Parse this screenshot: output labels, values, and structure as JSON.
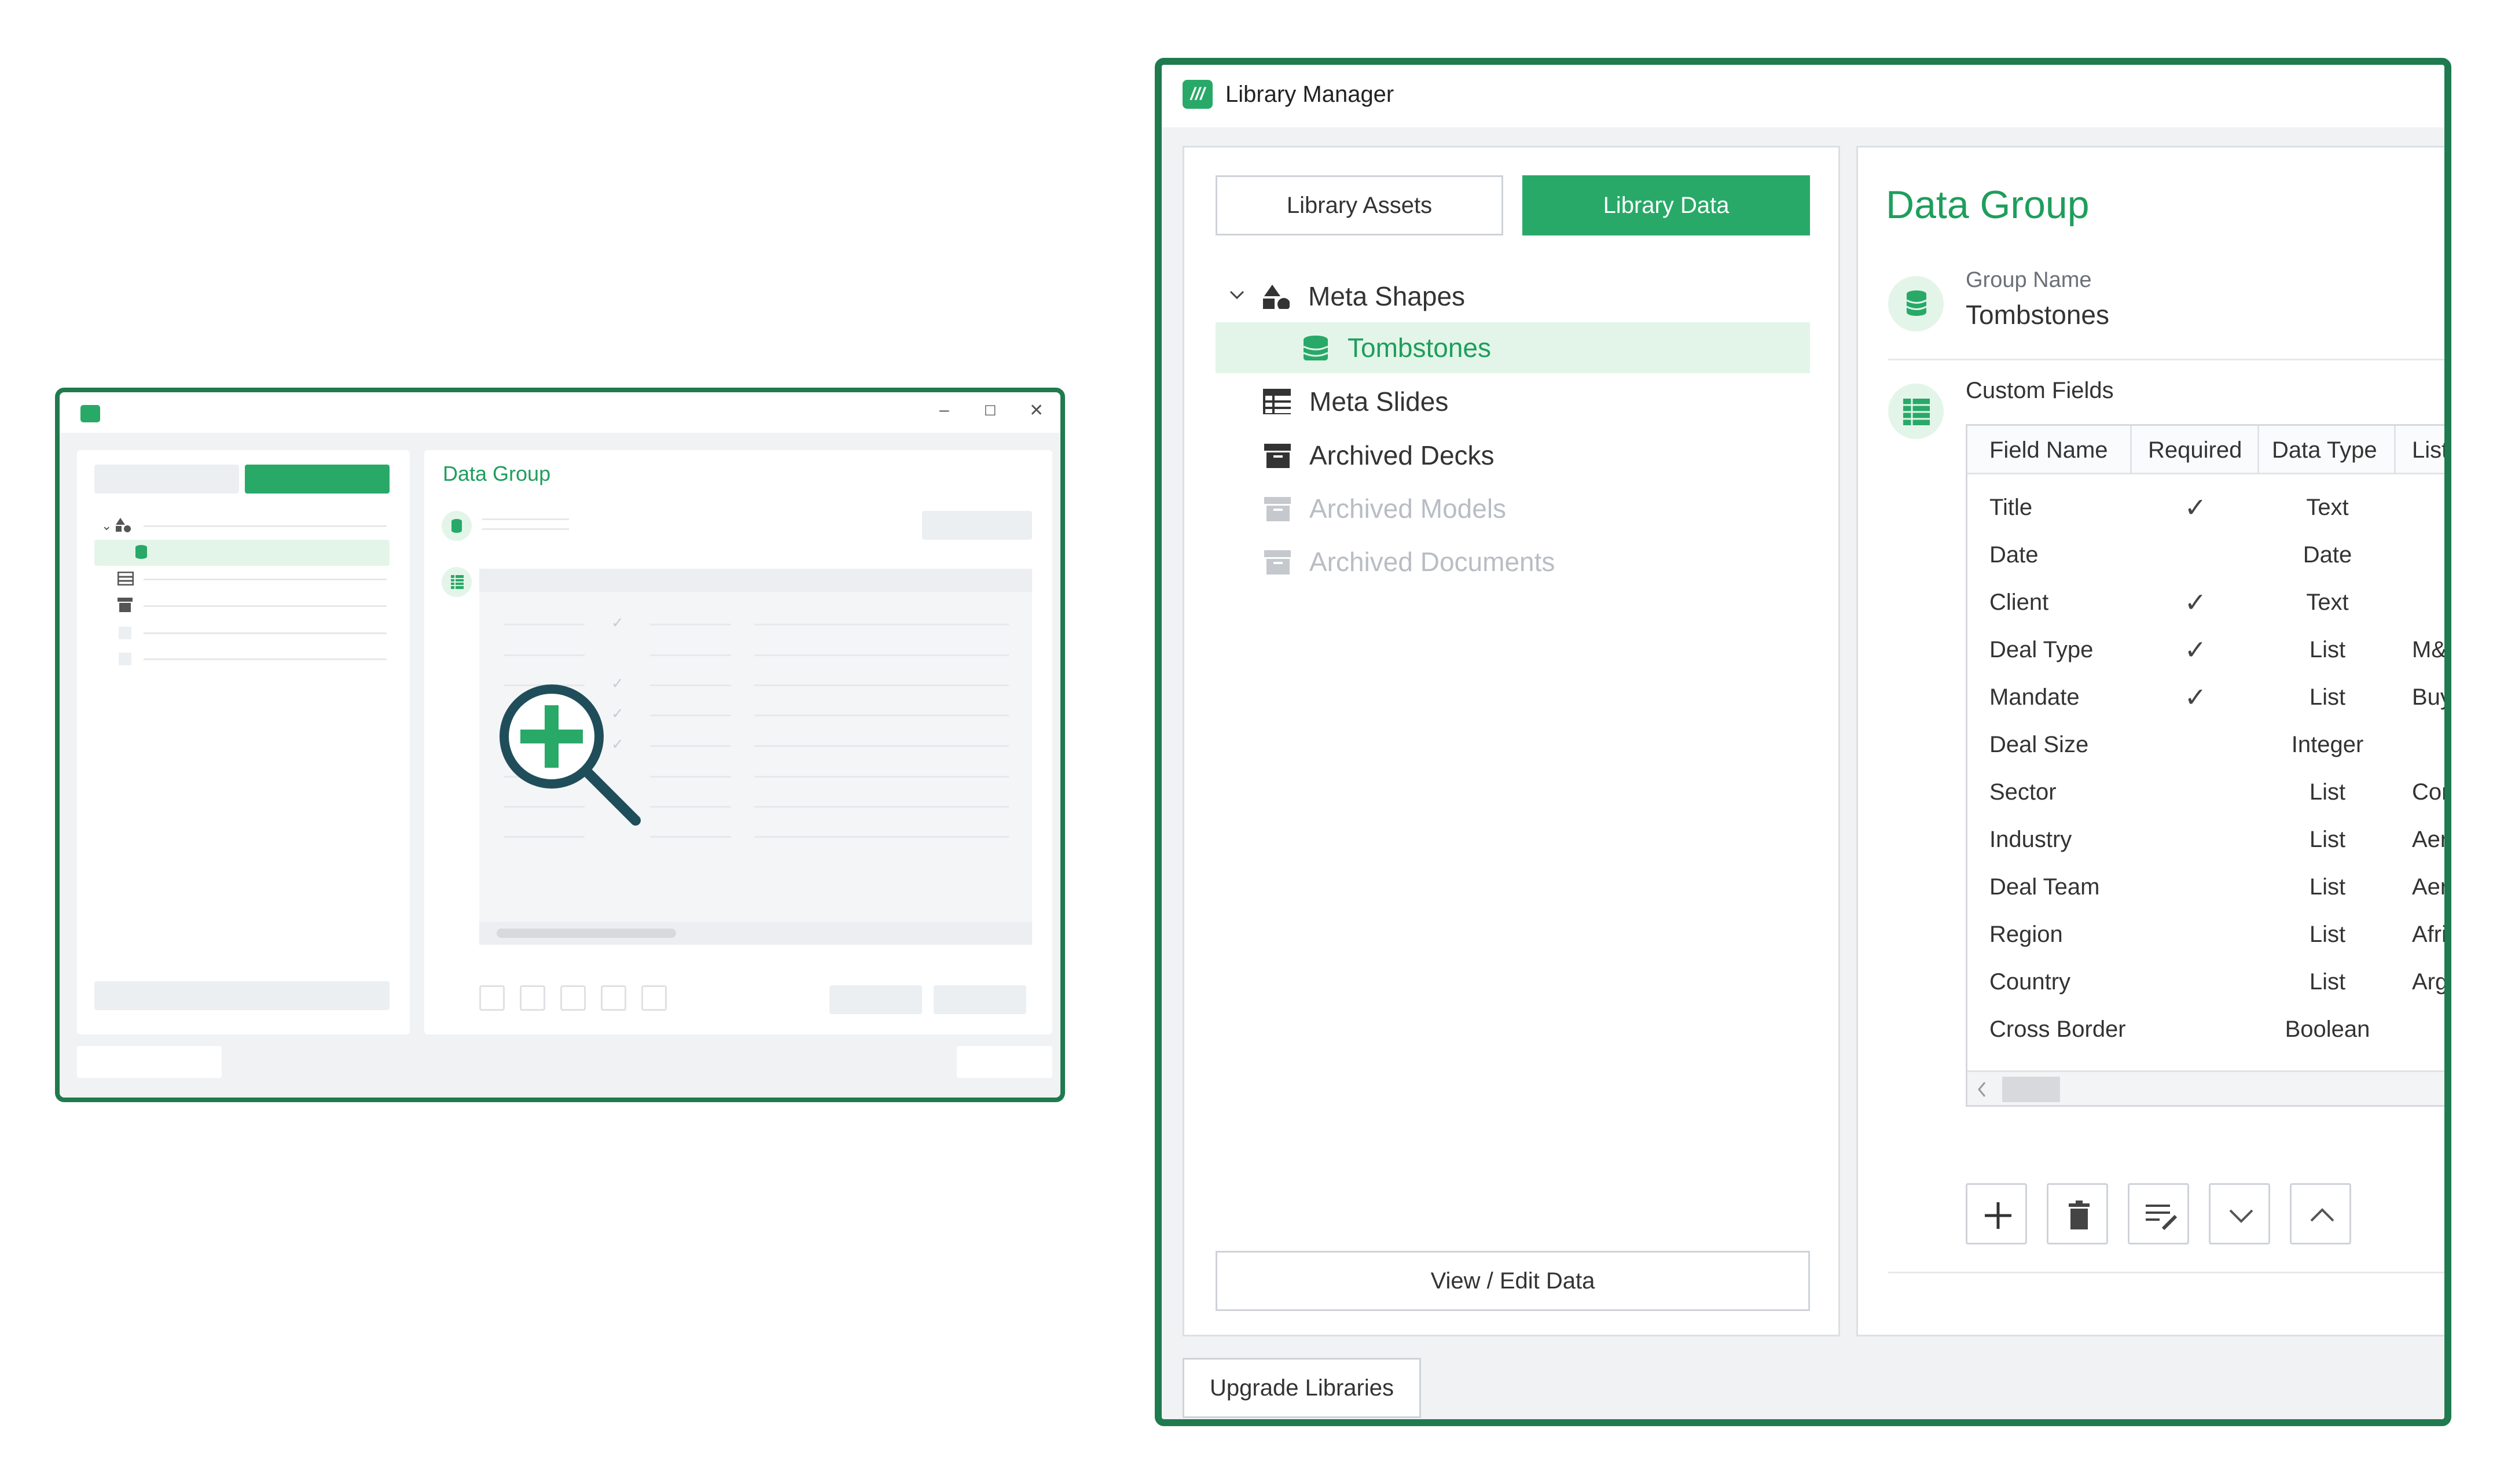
{
  "colors": {
    "accent": "#28a968",
    "frame": "#1f7a4e",
    "selected_bg": "#e3f5e9",
    "title_green": "#1e9e5c"
  },
  "mini": {
    "title": "Data Group",
    "controls": {
      "minimize": "–",
      "maximize": "☐",
      "close": "✕"
    }
  },
  "window": {
    "title": "Library Manager",
    "logo_glyph": "///"
  },
  "tabs": {
    "assets": "Library Assets",
    "data": "Library Data"
  },
  "tree": [
    {
      "label": "Meta Shapes",
      "icon": "shapes-icon"
    },
    {
      "label": "Tombstones",
      "icon": "database-icon"
    },
    {
      "label": "Meta Slides",
      "icon": "table-icon"
    },
    {
      "label": "Archived Decks",
      "icon": "archive-icon"
    },
    {
      "label": "Archived Models",
      "icon": "archive-icon"
    },
    {
      "label": "Archived Documents",
      "icon": "archive-icon"
    }
  ],
  "view_edit": "View / Edit Data",
  "upgrade": "Upgrade Libraries",
  "detail": {
    "title": "Data Group",
    "group_name_label": "Group Name",
    "group_name_value": "Tombstones",
    "custom_fields_label": "Custom Fields"
  },
  "table": {
    "headers": [
      "Field Name",
      "Required",
      "Data Type",
      "List"
    ],
    "rows": [
      {
        "name": "Title",
        "required": "✓",
        "type": "Text",
        "list": ""
      },
      {
        "name": "Date",
        "required": "",
        "type": "Date",
        "list": ""
      },
      {
        "name": "Client",
        "required": "✓",
        "type": "Text",
        "list": ""
      },
      {
        "name": "Deal Type",
        "required": "✓",
        "type": "List",
        "list": "M&A"
      },
      {
        "name": "Mandate",
        "required": "✓",
        "type": "List",
        "list": "Buy"
      },
      {
        "name": "Deal Size",
        "required": "",
        "type": "Integer",
        "list": ""
      },
      {
        "name": "Sector",
        "required": "",
        "type": "List",
        "list": "Con"
      },
      {
        "name": "Industry",
        "required": "",
        "type": "List",
        "list": "Aero"
      },
      {
        "name": "Deal Team",
        "required": "",
        "type": "List",
        "list": "Aero"
      },
      {
        "name": "Region",
        "required": "",
        "type": "List",
        "list": "Afric"
      },
      {
        "name": "Country",
        "required": "",
        "type": "List",
        "list": "Arge"
      },
      {
        "name": "Cross Border",
        "required": "",
        "type": "Boolean",
        "list": ""
      }
    ]
  }
}
